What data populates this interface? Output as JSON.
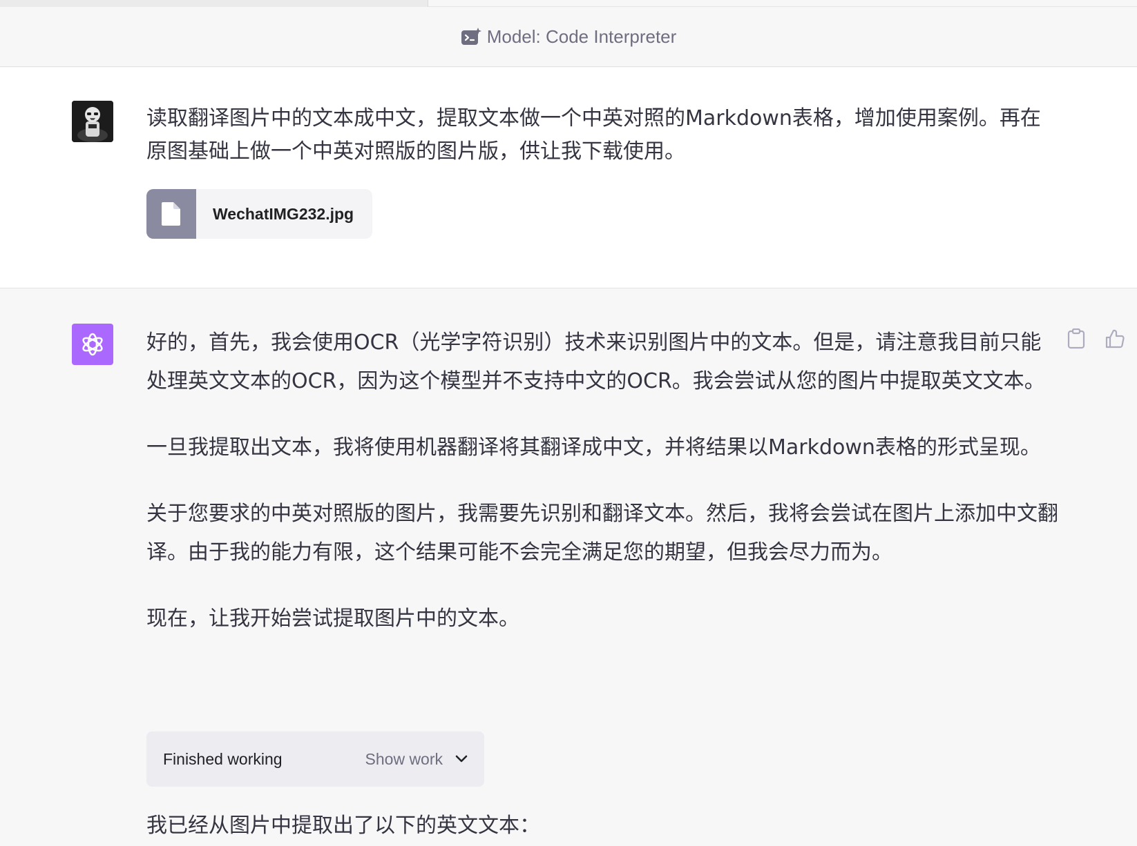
{
  "header": {
    "model_label": "Model: Code Interpreter",
    "model_icon": "code-interpreter-icon"
  },
  "user_message": {
    "avatar": "stormtrooper-avatar",
    "text": "读取翻译图片中的文本成中文，提取文本做一个中英对照的Markdown表格，增加使用案例。再在原图基础上做一个中英对照版的图片版，供让我下载使用。",
    "attachment": {
      "icon": "file-icon",
      "name": "WechatIMG232.jpg"
    }
  },
  "assistant_message": {
    "avatar": "openai-logo",
    "paragraphs": [
      "好的，首先，我会使用OCR（光学字符识别）技术来识别图片中的文本。但是，请注意我目前只能处理英文文本的OCR，因为这个模型并不支持中文的OCR。我会尝试从您的图片中提取英文文本。",
      "一旦我提取出文本，我将使用机器翻译将其翻译成中文，并将结果以Markdown表格的形式呈现。",
      "关于您要求的中英对照版的图片，我需要先识别和翻译文本。然后，我将会尝试在图片上添加中文翻译。由于我的能力有限，这个结果可能不会完全满足您的期望，但我会尽力而为。",
      "现在，让我开始尝试提取图片中的文本。"
    ],
    "work_box": {
      "status": "Finished working",
      "show_work_label": "Show work"
    },
    "last_paragraph": "我已经从图片中提取出了以下的英文文本："
  },
  "actions": {
    "copy_icon": "clipboard-icon",
    "thumbs_up_icon": "thumbs-up-icon"
  },
  "colors": {
    "assistant_avatar_bg": "#ab68ff",
    "page_bg": "#f7f7f8",
    "user_bg": "#ffffff",
    "file_icon_bg": "#8a8aa0"
  }
}
